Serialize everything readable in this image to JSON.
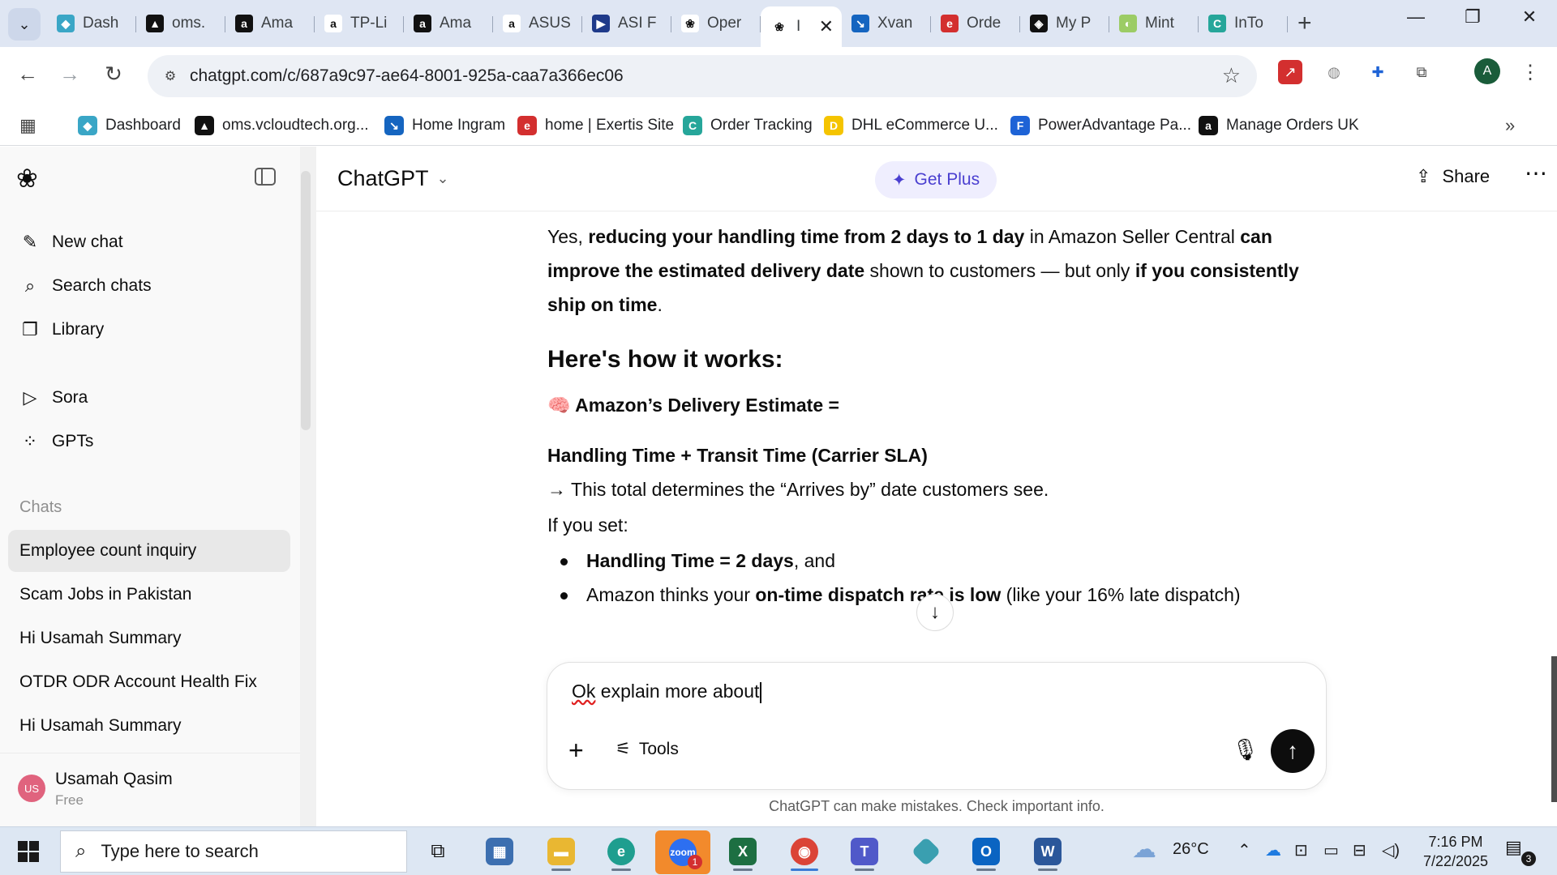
{
  "browser": {
    "tabs": [
      {
        "label": "Dash",
        "color": "#3aa6c6",
        "glyph": "◆"
      },
      {
        "label": "oms.",
        "color": "#111111",
        "glyph": "▲"
      },
      {
        "label": "Ama",
        "color": "#111111",
        "glyph": "a"
      },
      {
        "label": "TP-Li",
        "color": "#ffffff",
        "glyph": "a"
      },
      {
        "label": "Ama",
        "color": "#111111",
        "glyph": "a"
      },
      {
        "label": "ASUS",
        "color": "#ffffff",
        "glyph": "a"
      },
      {
        "label": "ASI F",
        "color": "#1f3a8a",
        "glyph": "▶"
      },
      {
        "label": "Oper",
        "color": "#ffffff",
        "glyph": "❀"
      },
      {
        "label": "I",
        "color": "#ffffff",
        "glyph": "❀"
      },
      {
        "label": "Xvan",
        "color": "#1565c0",
        "glyph": "↘"
      },
      {
        "label": "Orde",
        "color": "#d32f2f",
        "glyph": "e"
      },
      {
        "label": "My P",
        "color": "#111111",
        "glyph": "◈"
      },
      {
        "label": "Mint",
        "color": "#9ccc65",
        "glyph": "◐"
      },
      {
        "label": "InTo",
        "color": "#26a69a",
        "glyph": "C"
      }
    ],
    "url": "chatgpt.com/c/687a9c97-ae64-8001-925a-caa7a366ec06",
    "profile_initial": "A",
    "bookmarks": [
      {
        "label": "Dashboard",
        "color": "#3aa6c6",
        "glyph": "◆"
      },
      {
        "label": "oms.vcloudtech.org...",
        "color": "#111111",
        "glyph": "▲"
      },
      {
        "label": "Home Ingram",
        "color": "#1565c0",
        "glyph": "↘"
      },
      {
        "label": "home | Exertis Site",
        "color": "#d32f2f",
        "glyph": "e"
      },
      {
        "label": "Order Tracking",
        "color": "#26a69a",
        "glyph": "C"
      },
      {
        "label": "DHL eCommerce U...",
        "color": "#f5c400",
        "glyph": "D"
      },
      {
        "label": "PowerAdvantage Pa...",
        "color": "#1e63d6",
        "glyph": "F"
      },
      {
        "label": "Manage Orders UK",
        "color": "#111111",
        "glyph": "a"
      }
    ]
  },
  "sidebar": {
    "nav": [
      {
        "label": "New chat",
        "icon": "✎"
      },
      {
        "label": "Search chats",
        "icon": "⌕"
      },
      {
        "label": "Library",
        "icon": "❐"
      },
      {
        "label": "Sora",
        "icon": "▷"
      },
      {
        "label": "GPTs",
        "icon": "⁘"
      }
    ],
    "section_title": "Chats",
    "chats": [
      "Employee count inquiry",
      "Scam Jobs in Pakistan",
      "Hi Usamah Summary",
      "OTDR ODR Account Health Fix",
      "Hi Usamah Summary"
    ],
    "user": {
      "name": "Usamah Qasim",
      "plan": "Free",
      "initials": "US"
    }
  },
  "header": {
    "model": "ChatGPT",
    "get_plus": "Get Plus",
    "share": "Share"
  },
  "message": {
    "p1": [
      {
        "t": "Yes, ",
        "b": false
      },
      {
        "t": "reducing your handling time from 2 days to 1 day",
        "b": true
      },
      {
        "t": " in Amazon Seller Central ",
        "b": false
      },
      {
        "t": "can improve the estimated delivery date",
        "b": true
      },
      {
        "t": " shown to customers — but only ",
        "b": false
      },
      {
        "t": "if you consistently ship on time",
        "b": true
      },
      {
        "t": ".",
        "b": false
      }
    ],
    "heading": "Here's how it works:",
    "estimate_label": "🧠 Amazon’s Delivery Estimate =",
    "formula": "Handling Time + Transit Time (Carrier SLA)",
    "formula_note": "→ This total determines the “Arrives by” date customers see.",
    "if_you_set": "If you set:",
    "bullet1_bold": "Handling Time = 2 days",
    "bullet1_rest": ", and",
    "bullet2_a": "Amazon thinks your ",
    "bullet2_bold": "on-time dispatch rate is low",
    "bullet2_rest": " (like your 16% late dispatch)"
  },
  "composer": {
    "text_word1": "Ok",
    "text_rest": " explain more about",
    "tools": "Tools",
    "disclaimer": "ChatGPT can make mistakes. Check important info."
  },
  "taskbar": {
    "search_placeholder": "Type here to search",
    "weather": "26°C",
    "time": "7:16 PM",
    "date": "7/22/2025",
    "zoom_badge": "1",
    "notifications": "3"
  }
}
